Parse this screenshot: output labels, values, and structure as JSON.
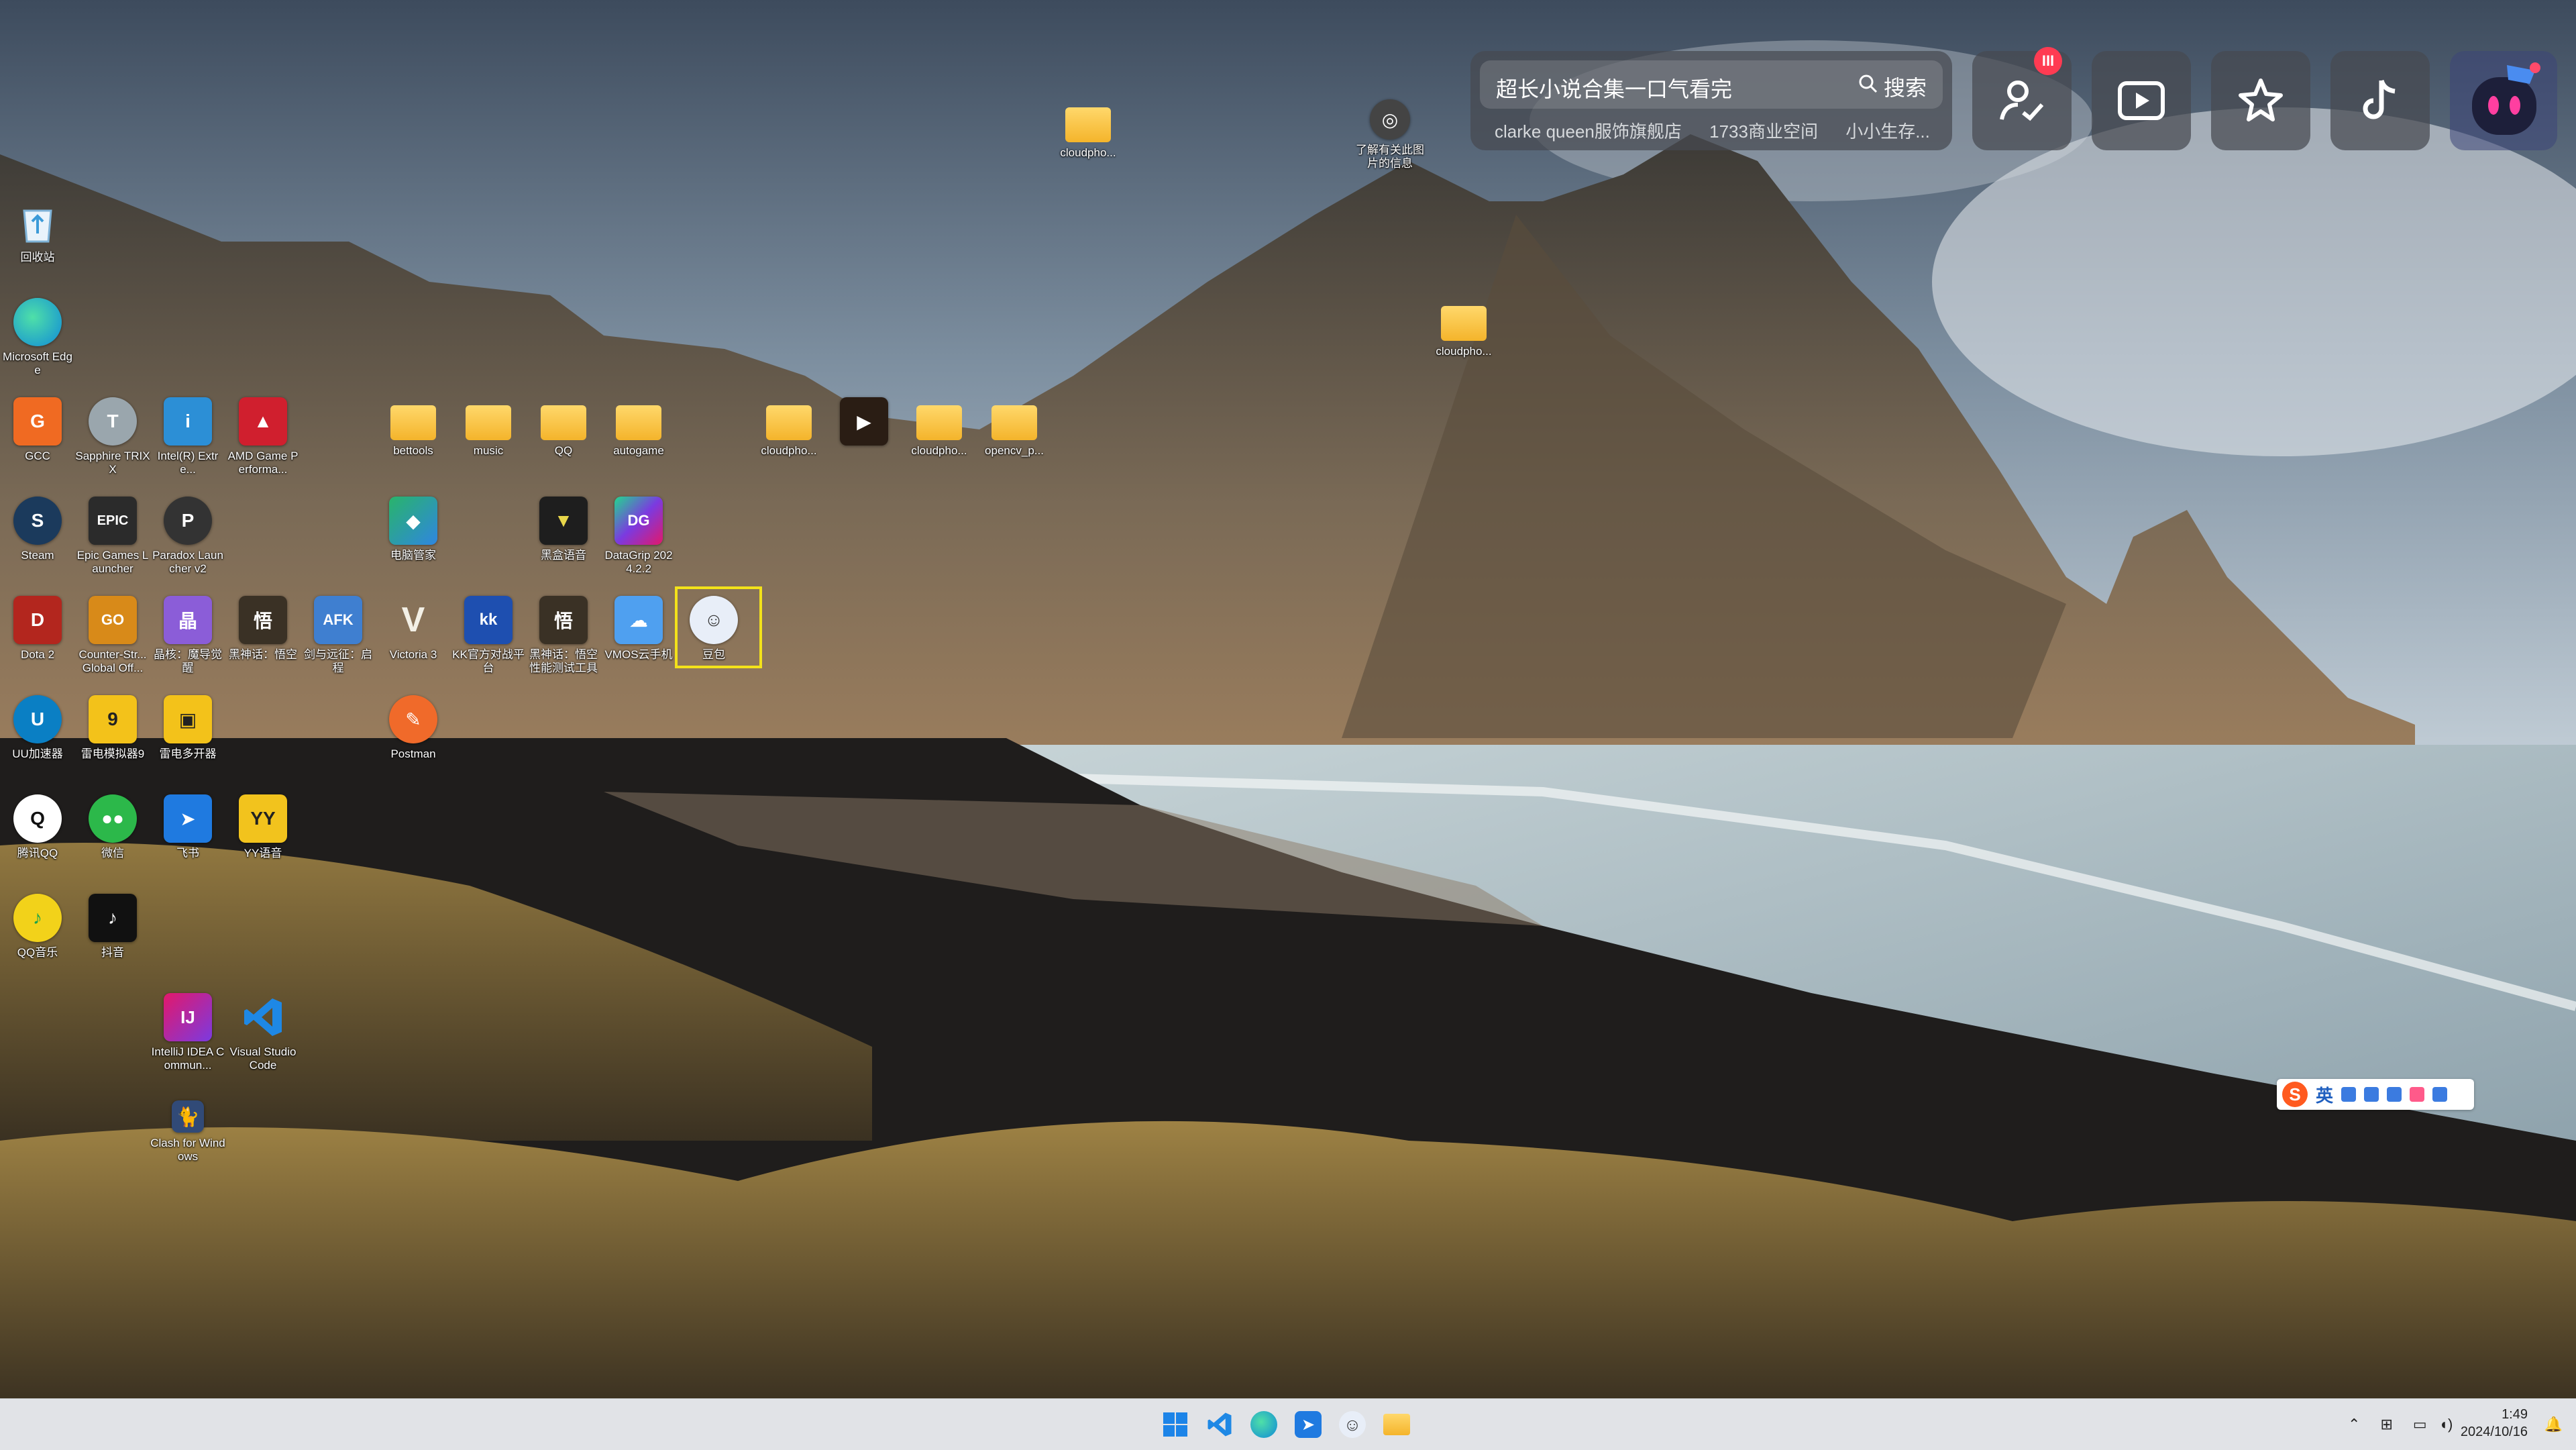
{
  "desktop": {
    "icons": [
      {
        "id": "recycle-bin",
        "label": "回收站",
        "kind": "app",
        "color": "#ffffff"
      },
      {
        "id": "edge",
        "label": "Microsoft Edge",
        "kind": "app",
        "color": "#0f8ad8"
      },
      {
        "id": "gcc",
        "label": "GCC",
        "kind": "app",
        "color": "#f06a22"
      },
      {
        "id": "sapphire-trixx",
        "label": "Sapphire TRIXX",
        "kind": "app",
        "color": "#9aa6ad"
      },
      {
        "id": "intel-extreme",
        "label": "Intel(R) Extre...",
        "kind": "app",
        "color": "#2c8fd6"
      },
      {
        "id": "amd-game",
        "label": "AMD Game Performa...",
        "kind": "app",
        "color": "#d01f2e"
      },
      {
        "id": "folder-bettools",
        "label": "bettools",
        "kind": "folder"
      },
      {
        "id": "folder-music",
        "label": "music",
        "kind": "folder"
      },
      {
        "id": "folder-qq",
        "label": "QQ",
        "kind": "folder"
      },
      {
        "id": "folder-autogame",
        "label": "autogame",
        "kind": "folder"
      },
      {
        "id": "cloudphone-1",
        "label": "cloudpho...",
        "kind": "folder"
      },
      {
        "id": "shortcut-video",
        "label": "",
        "kind": "app",
        "color": "#2a1d14"
      },
      {
        "id": "cloudphone-2",
        "label": "cloudpho...",
        "kind": "folder"
      },
      {
        "id": "opencv",
        "label": "opencv_p...",
        "kind": "folder"
      },
      {
        "id": "steam",
        "label": "Steam",
        "kind": "app",
        "color": "#1b3a5c"
      },
      {
        "id": "epic",
        "label": "Epic Games Launcher",
        "kind": "app",
        "color": "#2b2b2b"
      },
      {
        "id": "paradox",
        "label": "Paradox Launcher v2",
        "kind": "app",
        "color": "#333"
      },
      {
        "id": "computer-manager",
        "label": "电脑管家",
        "kind": "app",
        "color": "#29b46a"
      },
      {
        "id": "heiyun",
        "label": "黑盒语音",
        "kind": "app",
        "color": "#1e1e1e"
      },
      {
        "id": "datagrip",
        "label": "DataGrip 2024.2.2",
        "kind": "app",
        "color": "#7b3ae0"
      },
      {
        "id": "dota2",
        "label": "Dota 2",
        "kind": "app",
        "color": "#b3261e"
      },
      {
        "id": "csgo",
        "label": "Counter-Str... Global Off...",
        "kind": "app",
        "color": "#d88a19"
      },
      {
        "id": "genshin",
        "label": "晶核：魔导觉醒",
        "kind": "app",
        "color": "#8b5dd8"
      },
      {
        "id": "wukong",
        "label": "黑神话：悟空",
        "kind": "app",
        "color": "#3a3125"
      },
      {
        "id": "afk",
        "label": "剑与远征：启程",
        "kind": "app",
        "color": "#3f7fd0"
      },
      {
        "id": "victoria3",
        "label": "Victoria 3",
        "kind": "app",
        "color": "#7c6a4c"
      },
      {
        "id": "kk",
        "label": "KK官方对战平台",
        "kind": "app",
        "color": "#1e4fb0"
      },
      {
        "id": "wukong-bench",
        "label": "黑神话：悟空 性能测试工具",
        "kind": "app",
        "color": "#3a3125"
      },
      {
        "id": "vmos",
        "label": "VMOS云手机",
        "kind": "app",
        "color": "#4fa0f0"
      },
      {
        "id": "doubao",
        "label": "豆包",
        "kind": "app",
        "color": "#e8eef8"
      },
      {
        "id": "uu",
        "label": "UU加速器",
        "kind": "app",
        "color": "#0a7fc4"
      },
      {
        "id": "leidian9",
        "label": "雷电模拟器9",
        "kind": "app",
        "color": "#f3c21a"
      },
      {
        "id": "leidian-multi",
        "label": "雷电多开器",
        "kind": "app",
        "color": "#f3c21a"
      },
      {
        "id": "postman",
        "label": "Postman",
        "kind": "app",
        "color": "#f06a2a"
      },
      {
        "id": "qq",
        "label": "腾讯QQ",
        "kind": "app",
        "color": "#1b1b1b"
      },
      {
        "id": "wechat",
        "label": "微信",
        "kind": "app",
        "color": "#2cb84a"
      },
      {
        "id": "feishu",
        "label": "飞书",
        "kind": "app",
        "color": "#1f7ae0"
      },
      {
        "id": "yy",
        "label": "YY语音",
        "kind": "app",
        "color": "#f2c31d"
      },
      {
        "id": "qqmusic",
        "label": "QQ音乐",
        "kind": "app",
        "color": "#f2d21a"
      },
      {
        "id": "douyin",
        "label": "抖音",
        "kind": "app",
        "color": "#111111"
      },
      {
        "id": "intellij",
        "label": "IntelliJ IDEA Commun...",
        "kind": "app",
        "color": "#e3186a"
      },
      {
        "id": "vscode",
        "label": "Visual Studio Code",
        "kind": "app",
        "color": "#1e88e5"
      },
      {
        "id": "clash",
        "label": "Clash for Windows",
        "kind": "app",
        "color": "#314a77"
      },
      {
        "id": "cloudphone-top",
        "label": "cloudpho...",
        "kind": "folder"
      },
      {
        "id": "beauty-camera",
        "label": "了解有关此图片的信息",
        "kind": "app",
        "color": "#444"
      },
      {
        "id": "cloudphone-mid",
        "label": "cloudpho...",
        "kind": "folder"
      }
    ]
  },
  "search_widget": {
    "query": "超长小说合集一口气看完",
    "button_label": "搜索",
    "hints": [
      "clarke queen服饰旗舰店",
      "1733商业空间",
      "小小生存..."
    ]
  },
  "quick_actions": [
    {
      "name": "account-check",
      "icon": "user-check-icon",
      "badge": "III"
    },
    {
      "name": "video",
      "icon": "play-icon",
      "badge": ""
    },
    {
      "name": "favorites",
      "icon": "star-icon",
      "badge": ""
    },
    {
      "name": "douyin",
      "icon": "tiktok-icon",
      "badge": ""
    },
    {
      "name": "assistant",
      "icon": "robot-icon",
      "badge": ""
    }
  ],
  "ime": {
    "lang_label": "英"
  },
  "taskbar": {
    "apps": [
      "windows-start-icon",
      "vscode-icon",
      "edge-icon",
      "feishu-icon",
      "doubao-icon",
      "file-explorer-icon"
    ],
    "clock": {
      "time": "1:49",
      "date": "2024/10/16"
    }
  },
  "colors": {
    "selection": "#f3e21a",
    "folder": "#f4b42b",
    "badge": "#ff3b52"
  }
}
